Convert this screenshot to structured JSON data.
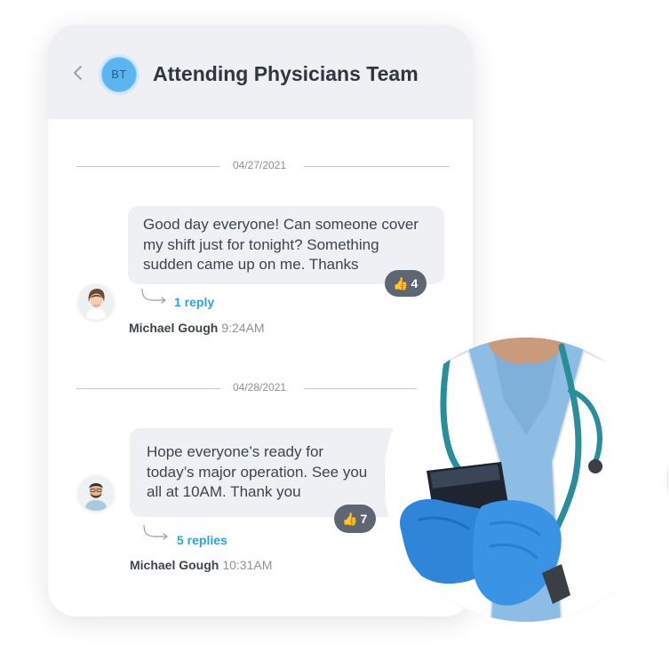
{
  "header": {
    "team_initials": "BT",
    "title": "Attending Physicians Team"
  },
  "messages": [
    {
      "date": "04/27/2021",
      "lines": [
        "Good day everyone! Can someone cover",
        "my shift just for tonight? Something",
        "sudden came up on me. Thanks"
      ],
      "reaction_icon": "👍",
      "reaction_count": "4",
      "replies": "1 reply",
      "author": "Michael Gough",
      "time": "9:24AM"
    },
    {
      "date": "04/28/2021",
      "lines": [
        "Hope everyone’s ready for",
        "today’s major operation. See you",
        "all at 10AM. Thank you"
      ],
      "reaction_icon": "👍",
      "reaction_count": "7",
      "replies": "5 replies",
      "author": "Michael Gough",
      "time": "10:31AM"
    }
  ],
  "colors": {
    "accent": "#2ea3d8",
    "bubble": "#eef0f4",
    "reaction": "#5e6673",
    "avatar_team": "#5cb5ef"
  },
  "icons": [
    "chevron-left-icon",
    "reply-arrow-icon",
    "thumbs-up-icon"
  ]
}
